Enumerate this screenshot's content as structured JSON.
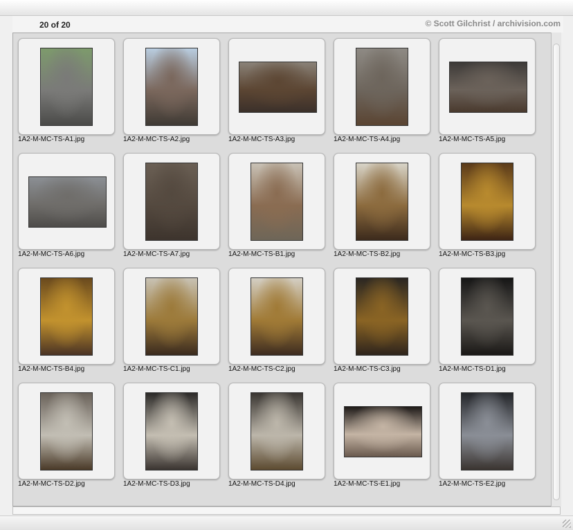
{
  "header": {
    "count": "20 of 20",
    "credit": "© Scott Gilchrist / archivision.com"
  },
  "thumbnails": [
    {
      "filename": "1A2-M-MC-TS-A1.jpg",
      "shape": "portrait",
      "colors": [
        "#7d9a6c",
        "#7a7a78",
        "#4a4a48"
      ]
    },
    {
      "filename": "1A2-M-MC-TS-A2.jpg",
      "shape": "portrait",
      "colors": [
        "#b9cde0",
        "#7a675c",
        "#3f3a34"
      ]
    },
    {
      "filename": "1A2-M-MC-TS-A3.jpg",
      "shape": "landscape",
      "colors": [
        "#8a8278",
        "#5c4633",
        "#3b302a"
      ]
    },
    {
      "filename": "1A2-M-MC-TS-A4.jpg",
      "shape": "portrait",
      "colors": [
        "#8e8a84",
        "#6d655c",
        "#5a4432"
      ]
    },
    {
      "filename": "1A2-M-MC-TS-A5.jpg",
      "shape": "landscape",
      "colors": [
        "#3d3a38",
        "#6b625a",
        "#4a3a2e"
      ]
    },
    {
      "filename": "1A2-M-MC-TS-A6.jpg",
      "shape": "landscape",
      "colors": [
        "#8b8f94",
        "#6f6d6a",
        "#4e4c4a"
      ]
    },
    {
      "filename": "1A2-M-MC-TS-A7.jpg",
      "shape": "portrait",
      "colors": [
        "#6a5f54",
        "#54493f",
        "#3d342d"
      ]
    },
    {
      "filename": "1A2-M-MC-TS-B1.jpg",
      "shape": "portrait",
      "colors": [
        "#c9c2b6",
        "#8a6c52",
        "#6e6658"
      ]
    },
    {
      "filename": "1A2-M-MC-TS-B2.jpg",
      "shape": "portrait",
      "colors": [
        "#d8d4c8",
        "#8c6b3e",
        "#3c2a1c"
      ]
    },
    {
      "filename": "1A2-M-MC-TS-B3.jpg",
      "shape": "portrait",
      "colors": [
        "#5a3a1a",
        "#b88a2e",
        "#3d2414"
      ]
    },
    {
      "filename": "1A2-M-MC-TS-B4.jpg",
      "shape": "portrait",
      "colors": [
        "#6a4a1e",
        "#c2922e",
        "#4a3324"
      ]
    },
    {
      "filename": "1A2-M-MC-TS-C1.jpg",
      "shape": "portrait",
      "colors": [
        "#c8c2b4",
        "#9c7a3a",
        "#3a2a1e"
      ]
    },
    {
      "filename": "1A2-M-MC-TS-C2.jpg",
      "shape": "portrait",
      "colors": [
        "#d4cfc4",
        "#a07a36",
        "#3d2c20"
      ]
    },
    {
      "filename": "1A2-M-MC-TS-C3.jpg",
      "shape": "portrait",
      "colors": [
        "#2a2622",
        "#8a6424",
        "#2e241c"
      ]
    },
    {
      "filename": "1A2-M-MC-TS-D1.jpg",
      "shape": "portrait",
      "colors": [
        "#161616",
        "#5a5650",
        "#1a1816"
      ]
    },
    {
      "filename": "1A2-M-MC-TS-D2.jpg",
      "shape": "portrait",
      "colors": [
        "#6a625a",
        "#c2beb4",
        "#4a3a28"
      ]
    },
    {
      "filename": "1A2-M-MC-TS-D3.jpg",
      "shape": "portrait",
      "colors": [
        "#2c2a28",
        "#c4beb2",
        "#3a3430"
      ]
    },
    {
      "filename": "1A2-M-MC-TS-D4.jpg",
      "shape": "portrait",
      "colors": [
        "#3a3632",
        "#bcb6aa",
        "#5c4a30"
      ]
    },
    {
      "filename": "1A2-M-MC-TS-E1.jpg",
      "shape": "landscape",
      "colors": [
        "#1e1a18",
        "#c4b4a4",
        "#6a5a4e"
      ]
    },
    {
      "filename": "1A2-M-MC-TS-E2.jpg",
      "shape": "portrait",
      "colors": [
        "#24262a",
        "#8a8e96",
        "#3a3430"
      ]
    }
  ]
}
